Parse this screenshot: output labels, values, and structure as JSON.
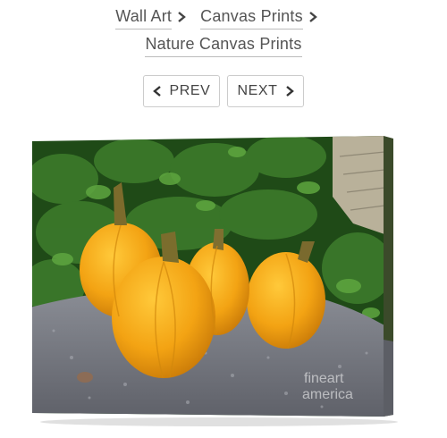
{
  "breadcrumb": {
    "items": [
      "Wall Art",
      "Canvas Prints",
      "Nature Canvas Prints"
    ]
  },
  "nav": {
    "prev_label": "PREV",
    "next_label": "NEXT"
  },
  "product": {
    "watermark_line1": "fineart",
    "watermark_line2": "america"
  },
  "icons": {
    "separator": "chevron-right-icon",
    "prev": "chevron-left-icon",
    "next": "chevron-right-icon"
  },
  "colors": {
    "pumpkin": "#f2a516",
    "foliage": "#2f6b22",
    "stone": "#7d7f86"
  }
}
